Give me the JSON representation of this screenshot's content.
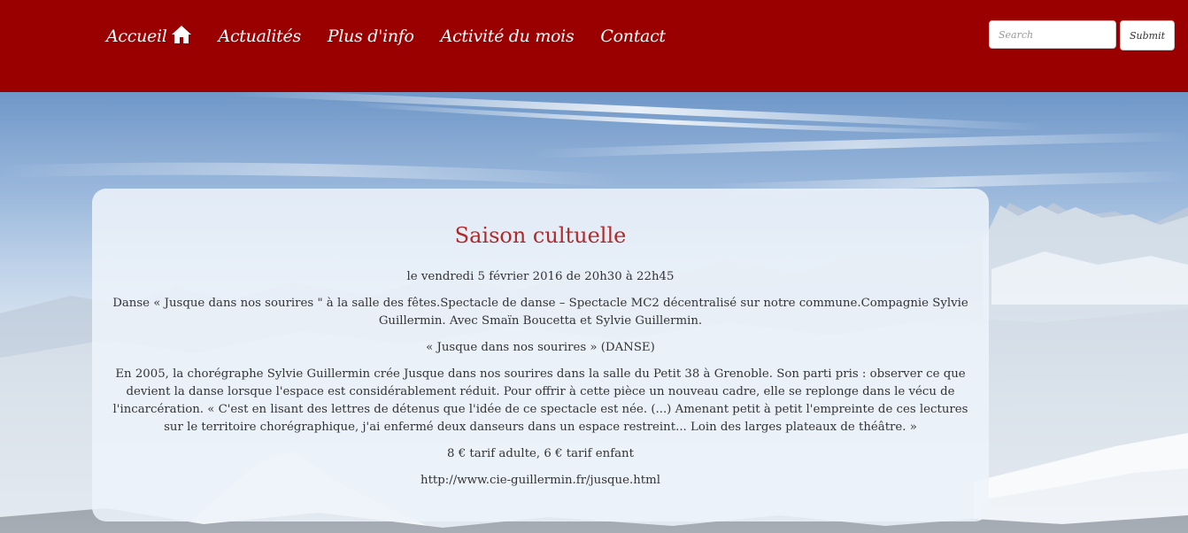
{
  "nav": {
    "items": [
      {
        "label": "Accueil",
        "icon": "home-icon"
      },
      {
        "label": "Actualités"
      },
      {
        "label": "Plus d'info"
      },
      {
        "label": "Activité du mois"
      },
      {
        "label": "Contact"
      }
    ]
  },
  "search": {
    "placeholder": "Search",
    "submit_label": "Submit"
  },
  "colors": {
    "navbar": "#9b0000",
    "title": "#b02a2a"
  },
  "article": {
    "title": "Saison cultuelle",
    "date": "le vendredi 5 février 2016 de 20h30 à 22h45",
    "intro": "Danse « Jusque dans nos sourires \" à la salle des fêtes.Spectacle de danse – Spectacle MC2 décentralisé sur notre commune.Compagnie Sylvie Guillermin. Avec Smaïn Boucetta et Sylvie Guillermin.",
    "subtitle": "« Jusque dans nos sourires » (DANSE)",
    "body": "En 2005, la chorégraphe Sylvie Guillermin crée Jusque dans nos sourires dans la salle du Petit 38 à Grenoble. Son parti pris : observer ce que devient la danse lorsque l'espace est considérablement réduit. Pour offrir à cette pièce un nouveau cadre, elle se replonge dans le vécu de l'incarcération. « C'est en lisant des lettres de détenus que l'idée de ce spectacle est née. (...) Amenant petit à petit l'empreinte de ces lectures sur le territoire chorégraphique, j'ai enfermé deux danseurs dans un espace restreint... Loin des larges plateaux de théâtre. »",
    "price": "8 € tarif adulte, 6 € tarif enfant",
    "link": "http://www.cie-guillermin.fr/jusque.html"
  }
}
